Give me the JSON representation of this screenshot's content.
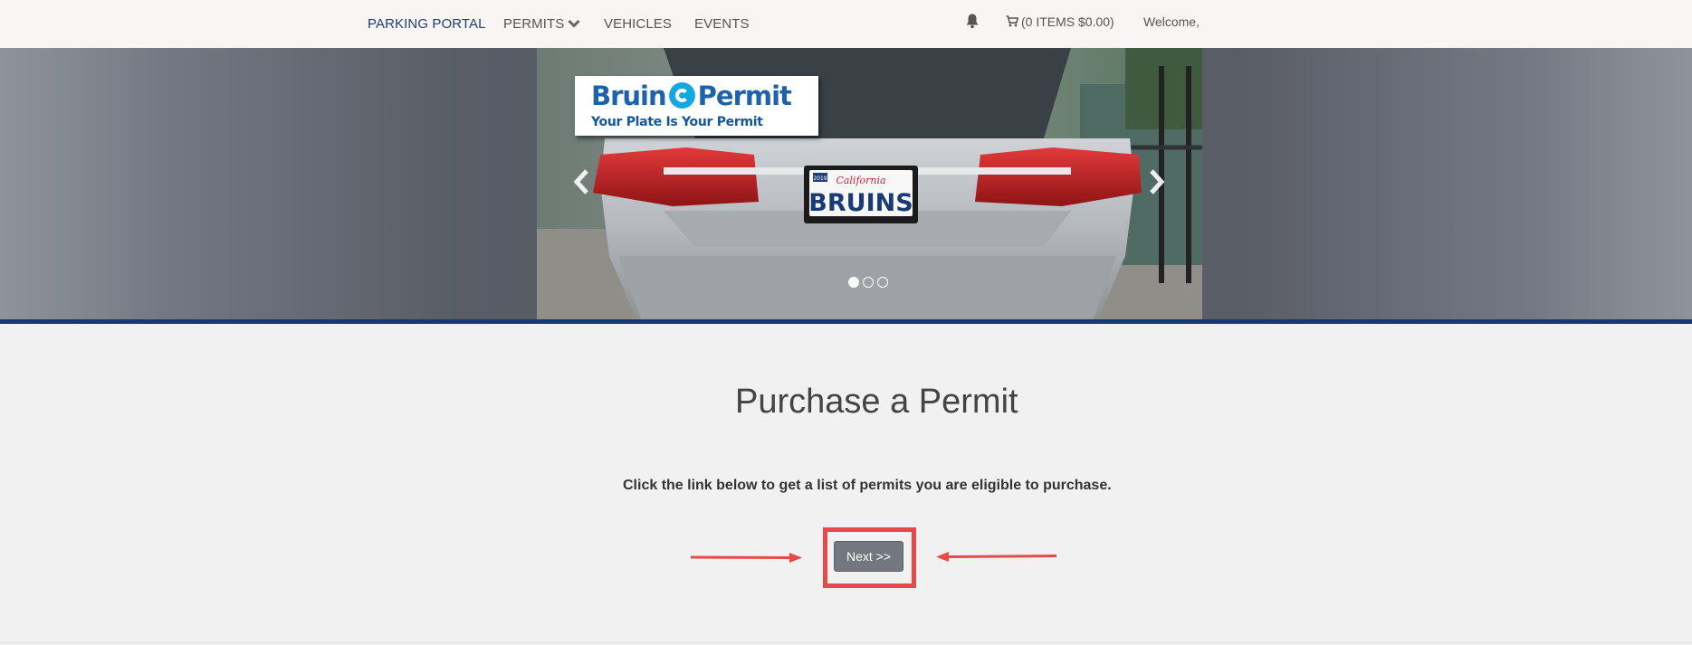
{
  "nav": {
    "brand": "PARKING PORTAL",
    "permits": "PERMITS",
    "vehicles": "VEHICLES",
    "events": "EVENTS",
    "cart": "(0 ITEMS $0.00)",
    "welcome": "Welcome,"
  },
  "hero": {
    "badge_title_left": "Bruin",
    "badge_title_right": "Permit",
    "badge_subtitle": "Your Plate Is Your Permit",
    "plate_state": "California",
    "plate_text": "BRUINS",
    "plate_year": "2019",
    "slide_count": 3,
    "active_slide": 1
  },
  "main": {
    "title": "Purchase a Permit",
    "instructions": "Click the link below to get a list of permits you are eligible to purchase.",
    "next_label": "Next >>"
  },
  "colors": {
    "brand": "#1f3f72",
    "hero_line": "#133a78",
    "highlight": "#e84a4a",
    "button": "#737880"
  },
  "icons": [
    "bell-icon",
    "cart-icon",
    "chevron-down-icon",
    "chevron-left-icon",
    "chevron-right-icon",
    "e-logo-icon"
  ]
}
